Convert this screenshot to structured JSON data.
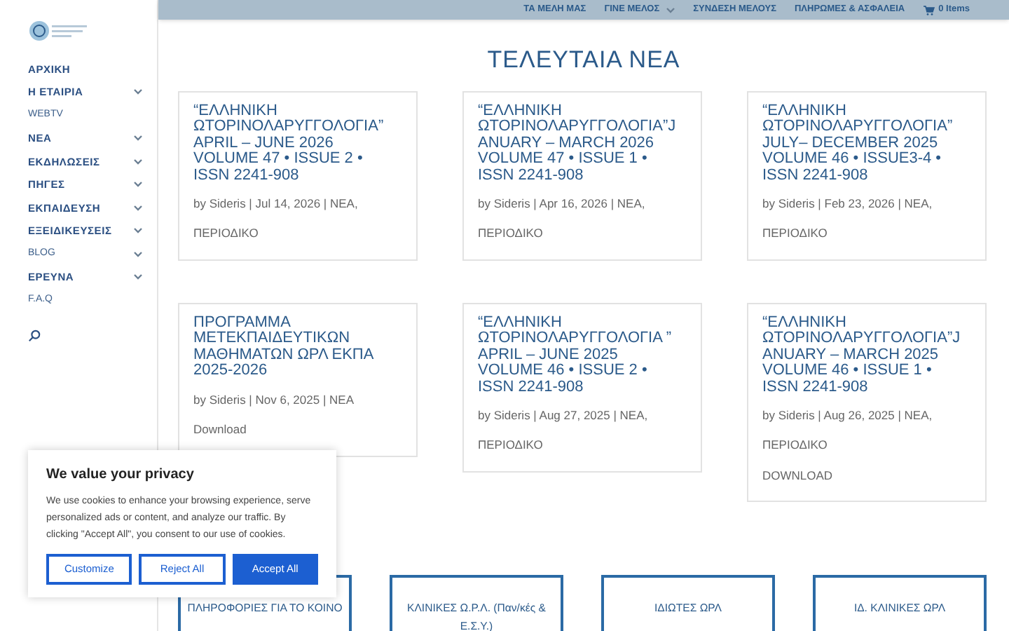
{
  "top_menu": [
    {
      "label": "ΤΑ ΜΕΛΗ ΜΑΣ",
      "has_submenu": false
    },
    {
      "label": "ΓΙΝΕ ΜΕΛΟΣ",
      "has_submenu": true
    },
    {
      "label": "ΣΥΝΔΕΣΗ ΜΕΛΟΥΣ",
      "has_submenu": false
    },
    {
      "label": "ΠΛΗΡΩΜΕΣ & ΑΣΦΑΛΕΙΑ",
      "has_submenu": false
    }
  ],
  "cart": {
    "label": "0 Items"
  },
  "sidebar": {
    "items": [
      {
        "label": "ΑΡΧΙΚΗ",
        "kind": "main",
        "has_submenu": false
      },
      {
        "label": "Η ΕΤΑΙΡΙΑ",
        "kind": "main",
        "has_submenu": true
      },
      {
        "label": "WEBTV",
        "kind": "minor",
        "has_submenu": false
      },
      {
        "label": "ΝΕΑ",
        "kind": "main",
        "has_submenu": true
      },
      {
        "label": "ΕΚΔΗΛΩΣΕΙΣ",
        "kind": "main",
        "has_submenu": true
      },
      {
        "label": "ΠΗΓΕΣ",
        "kind": "main",
        "has_submenu": true
      },
      {
        "label": "ΕΚΠΑΙΔΕΥΣΗ",
        "kind": "main",
        "has_submenu": true
      },
      {
        "label": "ΕΞΕΙΔΙΚΕΥΣΕΙΣ",
        "kind": "main",
        "has_submenu": true
      },
      {
        "label": "BLOG",
        "kind": "minor",
        "has_submenu": true
      },
      {
        "label": "ΕΡΕΥΝΑ",
        "kind": "main",
        "has_submenu": true
      },
      {
        "label": "F.A.Q",
        "kind": "minor",
        "has_submenu": false
      }
    ]
  },
  "heading": "ΤΕΛΕΥΤΑΙΑ ΝΕΑ",
  "posts": [
    {
      "title": "“ΕΛΛΗΝΙΚΗ ΩΤΟΡΙΝΟΛΑΡΥΓΓΟΛΟΓΙΑ” APRIL – JUNE 2026 VOLUME 47 • ISSUE 2 • ISSN 2241-908",
      "meta": "by Sideris | Jul 14, 2026 | NEA,",
      "category": "ΠΕΡΙΟΔΙΚΟ"
    },
    {
      "title": "“ΕΛΛΗΝΙΚΗ ΩΤΟΡΙΝΟΛΑΡΥΓΓΟΛΟΓΙΑ”J ANUARY – MARCH 2026 VOLUME 47 • ISSUE 1 • ISSN 2241-908",
      "meta": "by Sideris | Apr 16, 2026 | NEA,",
      "category": "ΠΕΡΙΟΔΙΚΟ"
    },
    {
      "title": "“ΕΛΛΗΝΙΚΗ ΩΤΟΡΙΝΟΛΑΡΥΓΓΟΛΟΓΙΑ” JULY– DECEMBER 2025 VOLUME 46 • ISSUE3-4 • ISSN 2241-908",
      "meta": "by Sideris | Feb 23, 2026 | NEA,",
      "category": "ΠΕΡΙΟΔΙΚΟ"
    },
    {
      "title": "ΠΡΟΓΡΑΜΜΑ ΜΕΤΕΚΠΑΙΔΕΥΤΙΚΩΝ ΜΑΘΗΜΑΤΩΝ ΩΡΛ ΕΚΠΑ 2025-2026",
      "meta": "by Sideris | Nov 6, 2025 | NEA",
      "excerpt": "Download"
    },
    {
      "title": "“ΕΛΛΗΝΙΚΗ ΩΤΟΡΙΝΟΛΑΡΥΓΓΟΛΟΓΙΑ ” APRIL – JUNE 2025 VOLUME 46 • ISSUE 2 • ISSN 2241-908",
      "meta": "by Sideris | Aug 27, 2025 | NEA,",
      "category": "ΠΕΡΙΟΔΙΚΟ"
    },
    {
      "title": "“ΕΛΛΗΝΙΚΗ ΩΤΟΡΙΝΟΛΑΡΥΓΓΟΛΟΓΙΑ”J ANUARY – MARCH 2025 VOLUME 46 • ISSUE 1 • ISSN 2241-908",
      "meta": "by Sideris | Aug 26, 2025 | NEA,",
      "category": "ΠΕΡΙΟΔΙΚΟ",
      "excerpt": "DOWNLOAD"
    }
  ],
  "link_buttons": [
    "ΠΛΗΡΟΦΟΡΙΕΣ ΓΙΑ ΤΟ ΚΟΙΝΟ",
    "ΚΛΙΝΙΚΕΣ Ω.Ρ.Λ. (Παν/κές & Ε.Σ.Υ.)",
    "ΙΔΙΩΤΕΣ ΩΡΛ",
    "ΙΔ. ΚΛΙΝΙΚΕΣ ΩΡΛ"
  ],
  "cookie_banner": {
    "title": "We value your privacy",
    "text": "We use cookies to enhance your browsing experience, serve personalized ads or content, and analyze our traffic. By clicking \"Accept All\", you consent to our use of cookies.",
    "buttons": [
      {
        "label": "Customize",
        "kind": "outline"
      },
      {
        "label": "Reject All",
        "kind": "outline"
      },
      {
        "label": "Accept All",
        "kind": "primary"
      }
    ]
  }
}
